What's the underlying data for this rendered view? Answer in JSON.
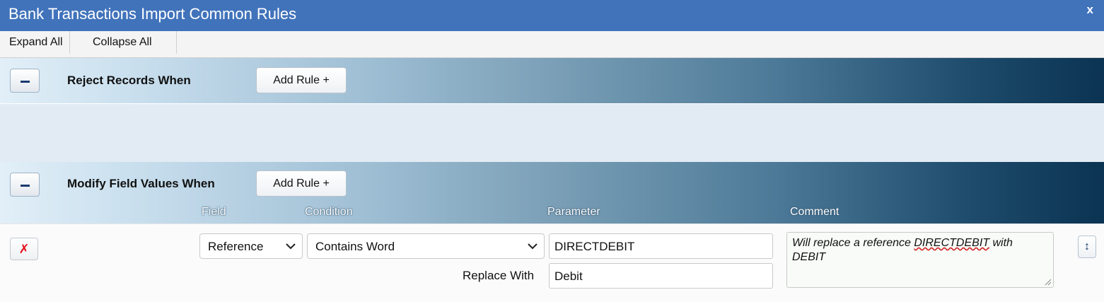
{
  "window": {
    "title": "Bank Transactions Import Common Rules",
    "close_label": "x"
  },
  "toolbar": {
    "expand_all": "Expand All",
    "collapse_all": "Collapse All"
  },
  "sections": [
    {
      "title": "Reject Records When",
      "add_rule_label": "Add Rule +"
    },
    {
      "title": "Modify Field Values When",
      "add_rule_label": "Add Rule +"
    }
  ],
  "columns": {
    "field": "Field",
    "condition": "Condition",
    "parameter": "Parameter",
    "comment": "Comment"
  },
  "rule": {
    "delete_label": "✗",
    "field": "Reference",
    "condition": "Contains Word",
    "parameter": "DIRECTDEBIT",
    "replace_with_label": "Replace With",
    "replace_with": "Debit",
    "comment_parts": [
      "Will replace a reference ",
      "DIRECTDEBIT",
      " with DEBIT"
    ],
    "move_label": "↕"
  }
}
